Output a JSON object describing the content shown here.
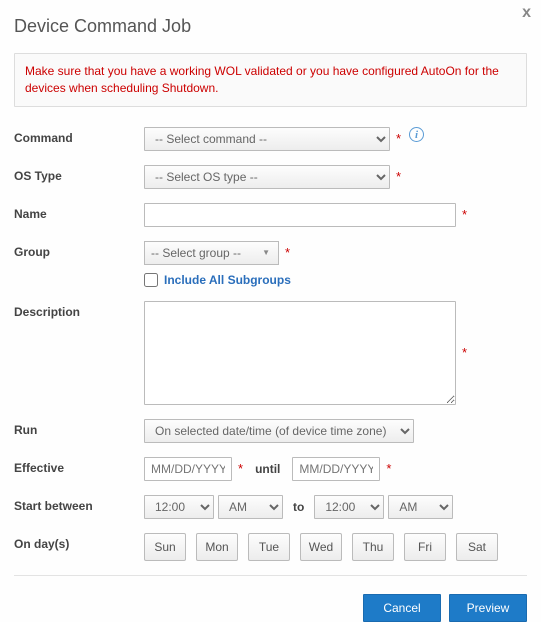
{
  "title": "Device Command Job",
  "close_label": "x",
  "warning": "Make sure that you have a working WOL validated or you have configured AutoOn for the devices when scheduling Shutdown.",
  "labels": {
    "command": "Command",
    "os_type": "OS Type",
    "name": "Name",
    "group": "Group",
    "include_subgroups": "Include All Subgroups",
    "description": "Description",
    "run": "Run",
    "effective": "Effective",
    "until": "until",
    "start_between": "Start between",
    "to": "to",
    "on_days": "On day(s)"
  },
  "placeholders": {
    "command": "-- Select command --",
    "os_type": "-- Select OS type --",
    "group": "-- Select group --",
    "date": "MM/DD/YYYY"
  },
  "values": {
    "run": "On selected date/time (of device time zone)",
    "time_from_hr": "12:00",
    "time_from_ampm": "AM",
    "time_to_hr": "12:00",
    "time_to_ampm": "AM"
  },
  "days": [
    "Sun",
    "Mon",
    "Tue",
    "Wed",
    "Thu",
    "Fri",
    "Sat"
  ],
  "buttons": {
    "cancel": "Cancel",
    "preview": "Preview"
  },
  "required_mark": "*",
  "info_glyph": "i"
}
